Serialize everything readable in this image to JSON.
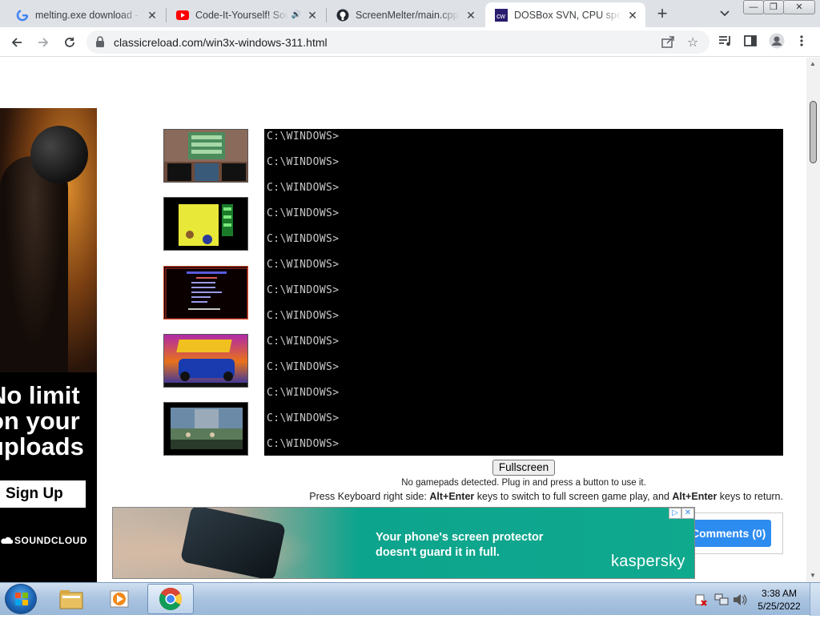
{
  "browser": {
    "tabs": [
      {
        "title": "melting.exe download - G",
        "icon": "google-icon",
        "active": false
      },
      {
        "title": "Code-It-Yourself! Sou",
        "icon": "youtube-icon",
        "active": false,
        "audio": true
      },
      {
        "title": "ScreenMelter/main.cpp at",
        "icon": "github-icon",
        "active": false
      },
      {
        "title": "DOSBox SVN, CPU speed",
        "icon": "dosbox-icon",
        "active": true
      }
    ],
    "url": "classicreload.com/win3x-windows-311.html"
  },
  "page": {
    "dos_lines": [
      "C:\\WINDOWS>",
      "C:\\WINDOWS>",
      "C:\\WINDOWS>",
      "C:\\WINDOWS>",
      "C:\\WINDOWS>",
      "C:\\WINDOWS>",
      "C:\\WINDOWS>",
      "C:\\WINDOWS>",
      "C:\\WINDOWS>",
      "C:\\WINDOWS>",
      "C:\\WINDOWS>",
      "C:\\WINDOWS>",
      "C:\\WINDOWS>"
    ],
    "fullscreen_label": "Fullscreen",
    "gamepad_message": "No gamepads detected. Plug in and press a button to use it.",
    "keyboard_message": {
      "pre": "Press Keyboard right side: ",
      "key1": "Alt+Enter",
      "mid": " keys to switch to full screen game play, and ",
      "key2": "Alt+Enter",
      "post": " keys to return."
    },
    "comments_label": "Comments (0)"
  },
  "ads": {
    "soundcloud": {
      "headline_lines": [
        "No limit",
        "on your",
        "uploads"
      ],
      "cta": "Sign Up",
      "brand": "SOUNDCLOUD"
    },
    "kaspersky": {
      "text_line1": "Your phone's screen protector",
      "text_line2": "doesn't guard it in full.",
      "brand": "kaspersky"
    }
  },
  "taskbar": {
    "time": "3:38 AM",
    "date": "5/25/2022"
  },
  "colors": {
    "tabstrip": "#dee1e6",
    "dos_bg": "#000000",
    "dos_text": "#c7c7c7",
    "comments_button": "#2d8cf0",
    "kaspersky_green": "#0fa98e"
  }
}
